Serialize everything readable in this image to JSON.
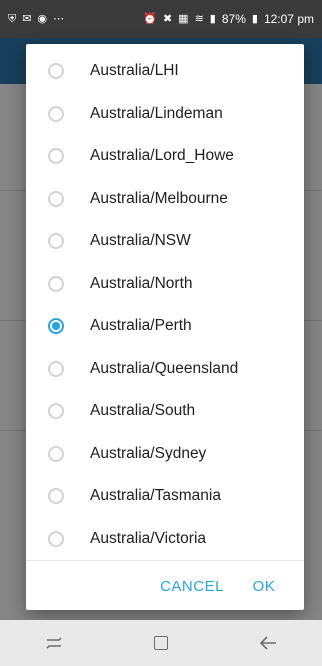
{
  "status_bar": {
    "battery": "87%",
    "time": "12:07 pm",
    "left_icons": [
      "shield-icon",
      "message-icon",
      "record-icon",
      "more-dots-icon"
    ],
    "right_icons": [
      "alarm-icon",
      "mute-icon",
      "hd-icon",
      "wifi-icon",
      "signal-icon",
      "battery-icon"
    ]
  },
  "dialog": {
    "selected": "Australia/Perth",
    "options": [
      {
        "label": "Australia/LHI",
        "checked": false
      },
      {
        "label": "Australia/Lindeman",
        "checked": false
      },
      {
        "label": "Australia/Lord_Howe",
        "checked": false
      },
      {
        "label": "Australia/Melbourne",
        "checked": false
      },
      {
        "label": "Australia/NSW",
        "checked": false
      },
      {
        "label": "Australia/North",
        "checked": false
      },
      {
        "label": "Australia/Perth",
        "checked": true
      },
      {
        "label": "Australia/Queensland",
        "checked": false
      },
      {
        "label": "Australia/South",
        "checked": false
      },
      {
        "label": "Australia/Sydney",
        "checked": false
      },
      {
        "label": "Australia/Tasmania",
        "checked": false
      },
      {
        "label": "Australia/Victoria",
        "checked": false
      }
    ],
    "cancel_label": "CANCEL",
    "ok_label": "OK"
  },
  "colors": {
    "accent": "#2aa3dc",
    "radio_unchecked": "#d2d2d2",
    "text": "#212121"
  },
  "navbar": {
    "icons": [
      "recent-apps-icon",
      "home-icon",
      "back-icon"
    ]
  }
}
